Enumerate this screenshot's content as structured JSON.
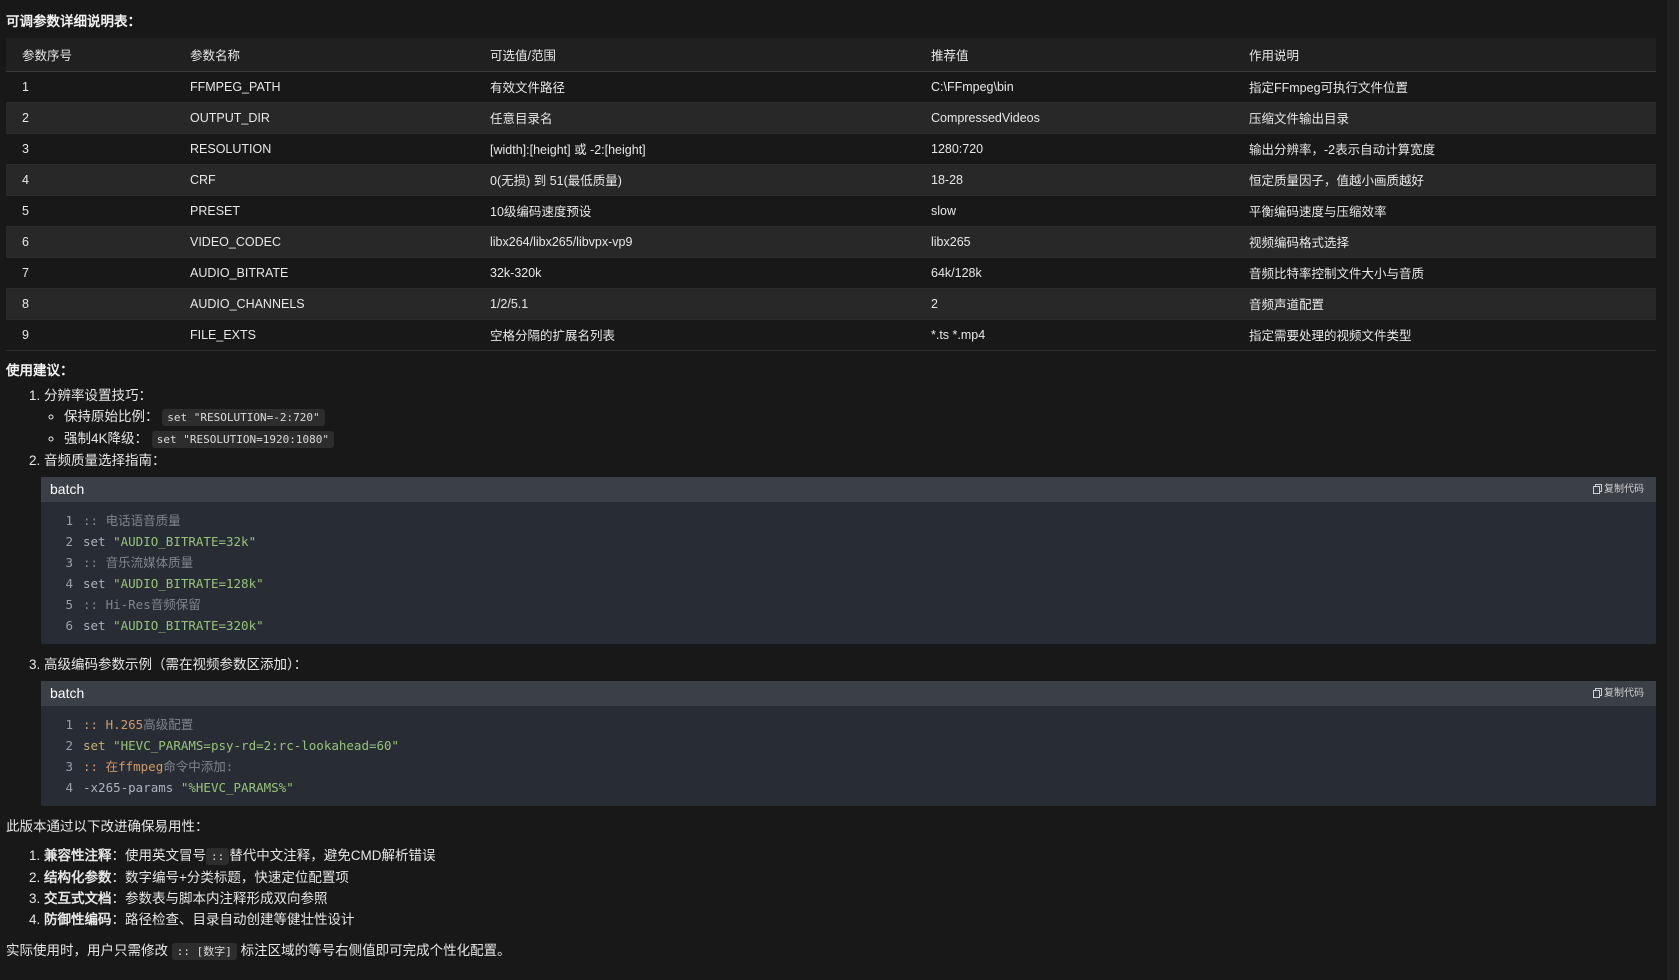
{
  "table_title": "可调参数详细说明表：",
  "table": {
    "headers": [
      "参数序号",
      "参数名称",
      "可选值/范围",
      "推荐值",
      "作用说明"
    ],
    "rows": [
      [
        "1",
        "FFMPEG_PATH",
        "有效文件路径",
        "C:\\FFmpeg\\bin",
        "指定FFmpeg可执行文件位置"
      ],
      [
        "2",
        "OUTPUT_DIR",
        "任意目录名",
        "CompressedVideos",
        "压缩文件输出目录"
      ],
      [
        "3",
        "RESOLUTION",
        "[width]:[height] 或 -2:[height]",
        "1280:720",
        "输出分辨率，-2表示自动计算宽度"
      ],
      [
        "4",
        "CRF",
        "0(无损) 到 51(最低质量)",
        "18-28",
        "恒定质量因子，值越小画质越好"
      ],
      [
        "5",
        "PRESET",
        "10级编码速度预设",
        "slow",
        "平衡编码速度与压缩效率"
      ],
      [
        "6",
        "VIDEO_CODEC",
        "libx264/libx265/libvpx-vp9",
        "libx265",
        "视频编码格式选择"
      ],
      [
        "7",
        "AUDIO_BITRATE",
        "32k-320k",
        "64k/128k",
        "音频比特率控制文件大小与音质"
      ],
      [
        "8",
        "AUDIO_CHANNELS",
        "1/2/5.1",
        "2",
        "音频声道配置"
      ],
      [
        "9",
        "FILE_EXTS",
        "空格分隔的扩展名列表",
        "*.ts *.mp4",
        "指定需要处理的视频文件类型"
      ]
    ]
  },
  "usage": {
    "title": "使用建议：",
    "item1": {
      "label": "分辨率设置技巧：",
      "sub1_label": "保持原始比例：",
      "sub1_code": "set \"RESOLUTION=-2:720\"",
      "sub2_label": "强制4K降级：",
      "sub2_code": "set \"RESOLUTION=1920:1080\""
    },
    "item2": {
      "label": "音频质量选择指南："
    },
    "item3": {
      "label": "高级编码参数示例（需在视频参数区添加）："
    }
  },
  "codeblock1": {
    "lang": "batch",
    "copy_label": "复制代码",
    "lines": [
      {
        "n": "1",
        "parts": [
          {
            "t": ":: 电话语音质量",
            "c": "cm"
          }
        ]
      },
      {
        "n": "2",
        "parts": [
          {
            "t": "set ",
            "c": "plain"
          },
          {
            "t": "\"AUDIO_BITRATE=32k\"",
            "c": "str"
          }
        ]
      },
      {
        "n": "3",
        "parts": [
          {
            "t": ":: 音乐流媒体质量",
            "c": "cm"
          }
        ]
      },
      {
        "n": "4",
        "parts": [
          {
            "t": "set ",
            "c": "plain"
          },
          {
            "t": "\"AUDIO_BITRATE=128k\"",
            "c": "str"
          }
        ]
      },
      {
        "n": "5",
        "parts": [
          {
            "t": ":: Hi-Res音频保留",
            "c": "cm"
          }
        ]
      },
      {
        "n": "6",
        "parts": [
          {
            "t": "set ",
            "c": "plain"
          },
          {
            "t": "\"AUDIO_BITRATE=320k\"",
            "c": "str"
          }
        ]
      }
    ]
  },
  "codeblock2": {
    "lang": "batch",
    "copy_label": "复制代码",
    "lines": [
      {
        "n": "1",
        "parts": [
          {
            "t": ":: ",
            "c": "cmo"
          },
          {
            "t": "H.265",
            "c": "cmo"
          },
          {
            "t": "高级配置",
            "c": "cm"
          }
        ]
      },
      {
        "n": "2",
        "parts": [
          {
            "t": "set ",
            "c": "kw"
          },
          {
            "t": "\"HEVC_PARAMS=psy-rd=2:rc-lookahead=60\"",
            "c": "str"
          }
        ]
      },
      {
        "n": "3",
        "parts": [
          {
            "t": ":: 在",
            "c": "cmo"
          },
          {
            "t": "ffmpeg",
            "c": "cmo"
          },
          {
            "t": "命令中添加:",
            "c": "cm"
          }
        ]
      },
      {
        "n": "4",
        "parts": [
          {
            "t": "-x265-params ",
            "c": "plain"
          },
          {
            "t": "\"%HEVC_PARAMS%\"",
            "c": "str"
          }
        ]
      }
    ]
  },
  "summary": {
    "intro": "此版本通过以下改进确保易用性：",
    "items": [
      {
        "bold": "兼容性注释",
        "pre": "：使用英文冒号",
        "code": "::",
        "post": "替代中文注释，避免CMD解析错误"
      },
      {
        "bold": "结构化参数",
        "pre": "：数字编号+分类标题，快速定位配置项",
        "code": "",
        "post": ""
      },
      {
        "bold": "交互式文档",
        "pre": "：参数表与脚本内注释形成双向参照",
        "code": "",
        "post": ""
      },
      {
        "bold": "防御性编码",
        "pre": "：路径检查、目录自动创建等健壮性设计",
        "code": "",
        "post": ""
      }
    ],
    "final_pre": "实际使用时，用户只需修改",
    "final_code": ":: [数字]",
    "final_post": "标注区域的等号右侧值即可完成个性化配置。"
  }
}
